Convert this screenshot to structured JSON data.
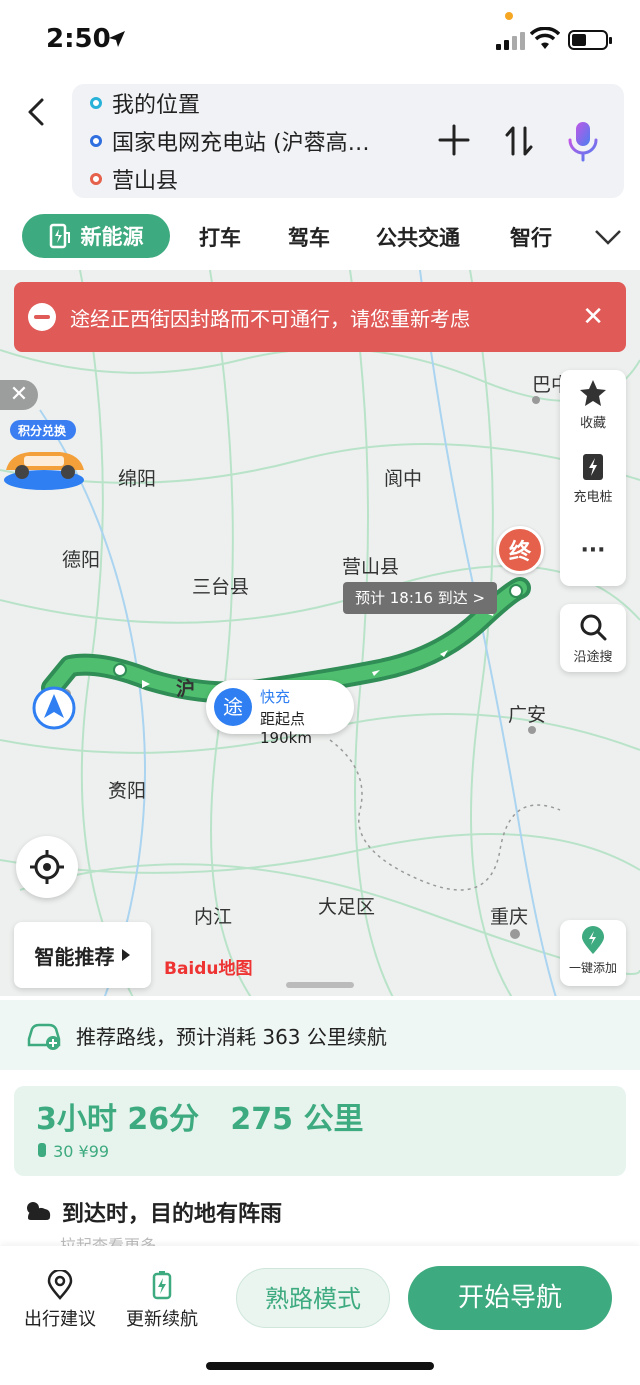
{
  "status": {
    "time": "2:50"
  },
  "route": {
    "origin": "我的位置",
    "waypoint": "国家电网充电站 (沪蓉高…",
    "destination": "营山县"
  },
  "tabs": {
    "active": "新能源",
    "items": [
      "打车",
      "驾车",
      "公共交通",
      "智行"
    ]
  },
  "alert": {
    "text": "途经正西街因封路而不可通行，请您重新考虑"
  },
  "map": {
    "cities": [
      "绵阳",
      "德阳",
      "三台县",
      "阆中",
      "营山县",
      "广安",
      "资阳",
      "内江",
      "大足区",
      "重庆",
      "巴中"
    ],
    "road_label": "沪",
    "eta": "预计 18:16 到达 >",
    "end_marker": "终",
    "via": {
      "badge": "途",
      "type": "快充",
      "distance": "距起点 190km"
    },
    "reward_label": "积分兑换",
    "logo": "Baidu地图"
  },
  "side_panel": {
    "favorite": "收藏",
    "charger": "充电桩",
    "search_along": "沿途搜",
    "one_tap_add": "一键添加"
  },
  "smart_recommend": "智能推荐",
  "recommend_row": "推荐路线，预计消耗 363 公里续航",
  "route_card": {
    "duration": "3小时 26分",
    "distance": "275 公里",
    "sub": "30 ¥99"
  },
  "weather": {
    "text": "到达时，目的地有阵雨",
    "pull": "拉起查看更多"
  },
  "bottom": {
    "suggestion": "出行建议",
    "update_range": "更新续航",
    "familiar_mode": "熟路模式",
    "start_nav": "开始导航"
  }
}
